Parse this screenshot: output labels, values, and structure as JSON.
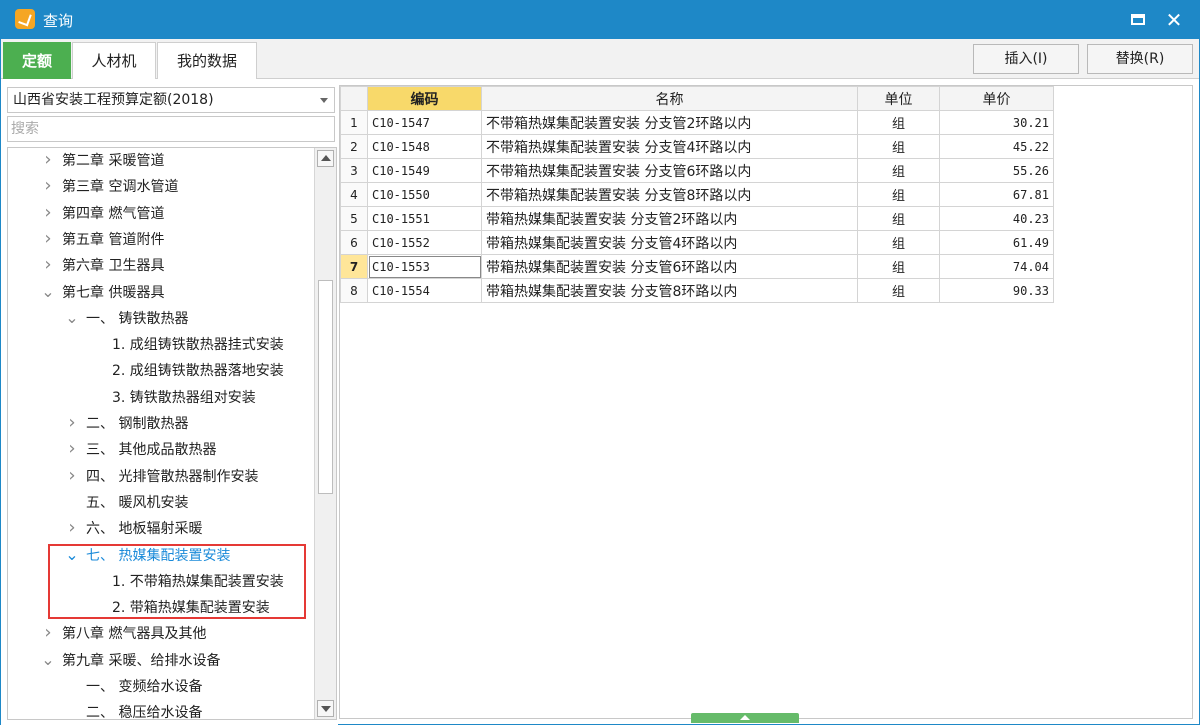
{
  "window": {
    "title": "查询",
    "colors": {
      "titlebar": "#1e88c7",
      "active_tab": "#4caf50",
      "highlight_text": "#1a8ad9",
      "selection_box": "#e53935"
    }
  },
  "tabs": [
    {
      "label": "定额",
      "active": true
    },
    {
      "label": "人材机",
      "active": false
    },
    {
      "label": "我的数据",
      "active": false
    }
  ],
  "toolbar": {
    "insert_label": "插入(I)",
    "replace_label": "替换(R)"
  },
  "left": {
    "quota_select": "山西省安装工程预算定额(2018)",
    "search_placeholder": "搜索",
    "tree": [
      {
        "label": "第二章  采暖管道",
        "state": "collapsed",
        "level": 0
      },
      {
        "label": "第三章  空调水管道",
        "state": "collapsed",
        "level": 0
      },
      {
        "label": "第四章  燃气管道",
        "state": "collapsed",
        "level": 0
      },
      {
        "label": "第五章  管道附件",
        "state": "collapsed",
        "level": 0
      },
      {
        "label": "第六章  卫生器具",
        "state": "collapsed",
        "level": 0
      },
      {
        "label": "第七章  供暖器具",
        "state": "expanded",
        "level": 0
      },
      {
        "label": "一、  铸铁散热器",
        "state": "expanded",
        "level": 1
      },
      {
        "label": "1. 成组铸铁散热器挂式安装",
        "state": "leaf",
        "level": 2
      },
      {
        "label": "2. 成组铸铁散热器落地安装",
        "state": "leaf",
        "level": 2
      },
      {
        "label": "3. 铸铁散热器组对安装",
        "state": "leaf",
        "level": 2
      },
      {
        "label": "二、  钢制散热器",
        "state": "collapsed",
        "level": 1
      },
      {
        "label": "三、  其他成品散热器",
        "state": "collapsed",
        "level": 1
      },
      {
        "label": "四、  光排管散热器制作安装",
        "state": "collapsed",
        "level": 1
      },
      {
        "label": "五、  暖风机安装",
        "state": "leaf",
        "level": 1
      },
      {
        "label": "六、  地板辐射采暖",
        "state": "collapsed",
        "level": 1
      },
      {
        "label": "七、  热媒集配装置安装",
        "state": "expanded",
        "level": 1,
        "highlight": true
      },
      {
        "label": "1. 不带箱热媒集配装置安装",
        "state": "leaf",
        "level": 2
      },
      {
        "label": "2. 带箱热媒集配装置安装",
        "state": "leaf",
        "level": 2
      },
      {
        "label": "第八章  燃气器具及其他",
        "state": "collapsed",
        "level": 0
      },
      {
        "label": "第九章  采暖、给排水设备",
        "state": "expanded",
        "level": 0
      },
      {
        "label": "一、  变频给水设备",
        "state": "leaf",
        "level": 1
      },
      {
        "label": "二、  稳压给水设备",
        "state": "leaf",
        "level": 1
      }
    ]
  },
  "grid": {
    "headers": {
      "code": "编码",
      "name": "名称",
      "unit": "单位",
      "price": "单价"
    },
    "active_row": 7,
    "rows": [
      {
        "n": "1",
        "code": "C10-1547",
        "name": "不带箱热媒集配装置安装 分支管2环路以内",
        "unit": "组",
        "price": "30.21"
      },
      {
        "n": "2",
        "code": "C10-1548",
        "name": "不带箱热媒集配装置安装 分支管4环路以内",
        "unit": "组",
        "price": "45.22"
      },
      {
        "n": "3",
        "code": "C10-1549",
        "name": "不带箱热媒集配装置安装 分支管6环路以内",
        "unit": "组",
        "price": "55.26"
      },
      {
        "n": "4",
        "code": "C10-1550",
        "name": "不带箱热媒集配装置安装 分支管8环路以内",
        "unit": "组",
        "price": "67.81"
      },
      {
        "n": "5",
        "code": "C10-1551",
        "name": "带箱热媒集配装置安装 分支管2环路以内",
        "unit": "组",
        "price": "40.23"
      },
      {
        "n": "6",
        "code": "C10-1552",
        "name": "带箱热媒集配装置安装 分支管4环路以内",
        "unit": "组",
        "price": "61.49"
      },
      {
        "n": "7",
        "code": "C10-1553",
        "name": "带箱热媒集配装置安装 分支管6环路以内",
        "unit": "组",
        "price": "74.04"
      },
      {
        "n": "8",
        "code": "C10-1554",
        "name": "带箱热媒集配装置安装 分支管8环路以内",
        "unit": "组",
        "price": "90.33"
      }
    ]
  }
}
